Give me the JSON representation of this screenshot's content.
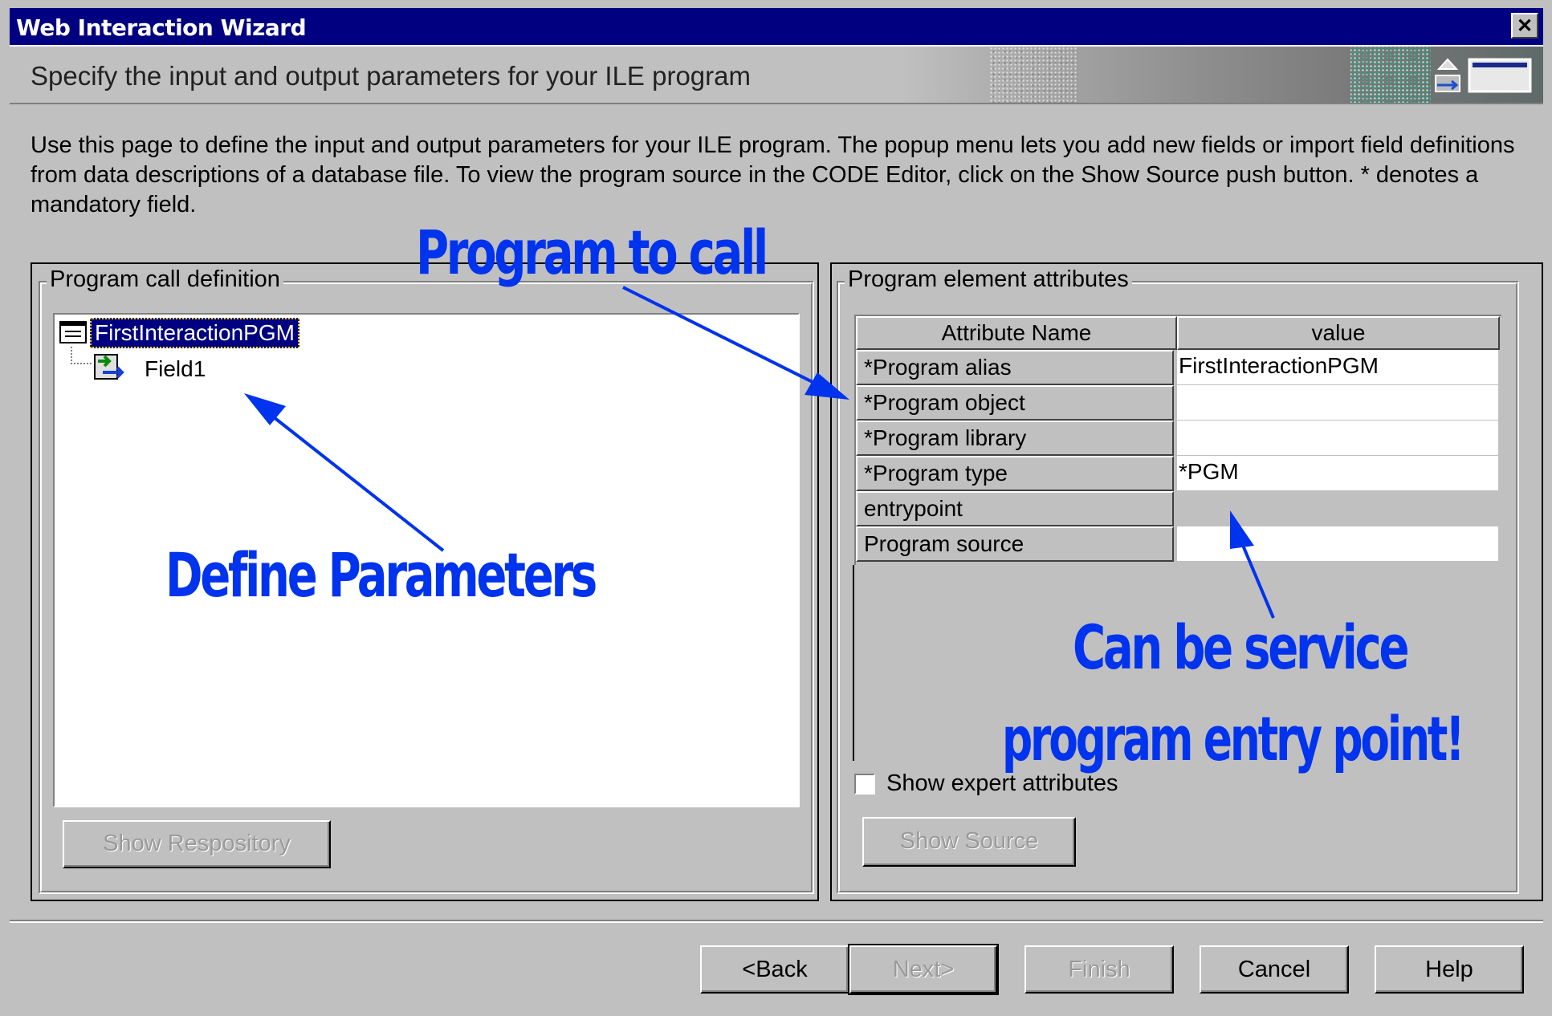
{
  "window": {
    "title": "Web Interaction Wizard",
    "close_label": "✕"
  },
  "header": {
    "title": "Specify the input and output parameters for your ILE program"
  },
  "description": "Use this page to define the input and output parameters for your ILE program. The popup menu lets you add new fields or import field definitions from data descriptions of a database file.  To view the program source in the CODE Editor, click on the Show Source push button. * denotes a mandatory field.",
  "left_panel": {
    "legend": "Program call definition",
    "tree": {
      "root": "FirstInteractionPGM",
      "children": [
        "Field1"
      ]
    },
    "show_repository_label": "Show Respository"
  },
  "right_panel": {
    "legend": "Program element attributes",
    "columns": [
      "Attribute Name",
      "value"
    ],
    "rows": [
      {
        "name": "*Program alias",
        "value": "FirstInteractionPGM"
      },
      {
        "name": "*Program object",
        "value": ""
      },
      {
        "name": "*Program library",
        "value": ""
      },
      {
        "name": "*Program type",
        "value": "*PGM"
      },
      {
        "name": "entrypoint",
        "value": ""
      },
      {
        "name": "Program source",
        "value": ""
      }
    ],
    "expert_checkbox_label": "Show expert attributes",
    "expert_checked": false,
    "show_source_label": "Show Source"
  },
  "buttons": {
    "back": "<Back",
    "next": "Next>",
    "finish": "Finish",
    "cancel": "Cancel",
    "help": "Help"
  },
  "annotations": {
    "program_to_call": "Program to call",
    "define_parameters": "Define Parameters",
    "service_line1": "Can be service",
    "service_line2": "program entry point!"
  },
  "colors": {
    "titlebar": "#000080",
    "annotation": "#0033ee",
    "panel": "#c0c0c0"
  }
}
